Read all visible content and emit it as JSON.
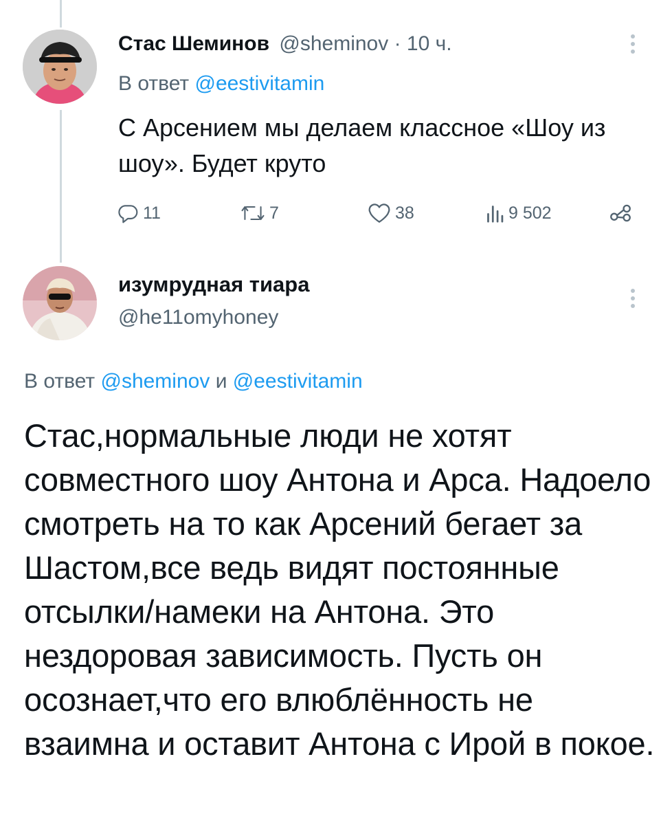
{
  "tweet1": {
    "author_name": "Стас Шеминов",
    "author_handle": "@sheminov",
    "time": "· 10 ч.",
    "reply_prefix": "В ответ",
    "reply_to": "@eestivitamin",
    "text": "С Арсением мы делаем классное «Шоу из шоу». Будет круто",
    "actions": {
      "replies": "11",
      "retweets": "7",
      "likes": "38",
      "views": "9 502"
    }
  },
  "tweet2": {
    "author_name": "изумрудная тиара",
    "author_handle": "@he11omyhoney",
    "reply_prefix": "В ответ",
    "reply_to_1": "@sheminov",
    "reply_joiner": "и",
    "reply_to_2": "@eestivitamin",
    "text": "Стас,нормальные люди не хотят совместного шоу Антона и Арса. Надоело смотреть на то как Арсений бегает за Шастом,все ведь видят постоянные отсылки/намеки на Антона. Это нездоровая зависимость. Пусть он осознает,что его влюблённость не взаимна и оставит Антона с Ирой в покое."
  },
  "icons": {
    "reply": "reply-icon",
    "retweet": "retweet-icon",
    "like": "heart-icon",
    "views": "views-chart-icon",
    "share": "share-icon",
    "more": "more-vertical-icon"
  },
  "colors": {
    "link": "#1d9bf0",
    "muted": "#536471",
    "thread_line": "#cfd9de"
  }
}
